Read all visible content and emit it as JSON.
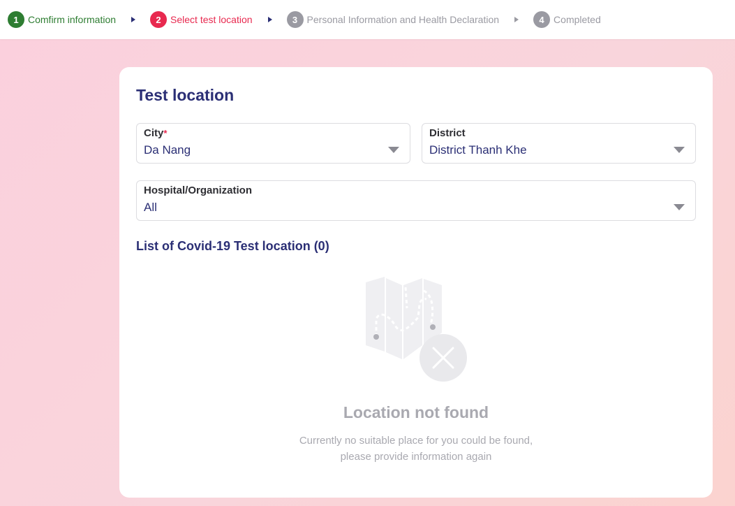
{
  "stepper": {
    "steps": [
      {
        "num": "1",
        "label": "Comfirm information",
        "color": "#2e7d32",
        "badge": "#2e7d32"
      },
      {
        "num": "2",
        "label": "Select test location",
        "color": "#e8294f",
        "badge": "#e8294f"
      },
      {
        "num": "3",
        "label": "Personal Information and Health Declaration",
        "color": "#9a9aa2",
        "badge": "#9a9aa2"
      },
      {
        "num": "4",
        "label": "Completed",
        "color": "#9a9aa2",
        "badge": "#9a9aa2"
      }
    ]
  },
  "card": {
    "title": "Test location",
    "city": {
      "label": "City",
      "required_mark": "*",
      "value": "Da Nang"
    },
    "district": {
      "label": "District",
      "value": "District Thanh Khe"
    },
    "hospital": {
      "label": "Hospital/Organization",
      "value": "All"
    },
    "list_title": "List of Covid-19 Test location (0)",
    "empty": {
      "title": "Location not found",
      "line1": "Currently no suitable place for you could be found,",
      "line2": "please provide information again",
      "icon": "map-not-found-icon"
    }
  }
}
